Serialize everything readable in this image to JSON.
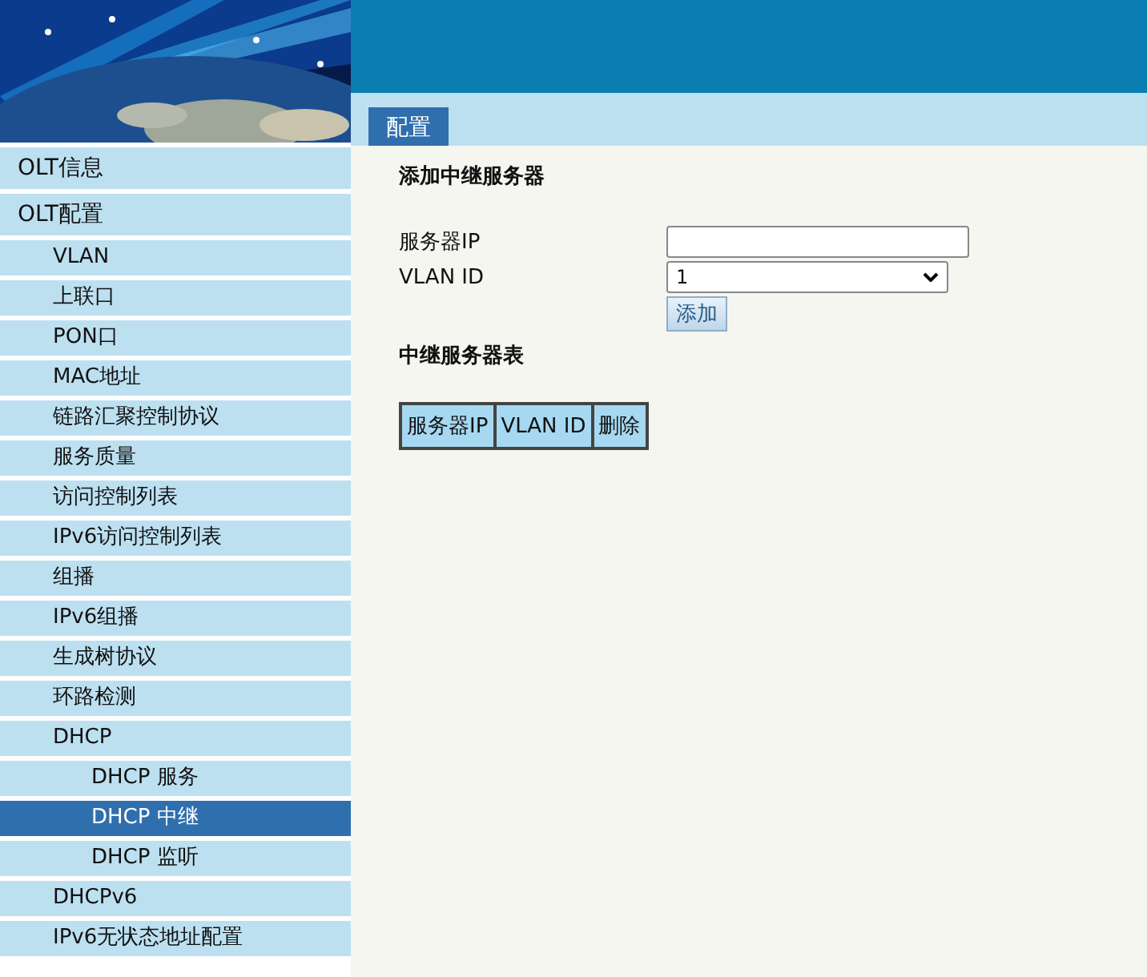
{
  "sidebar": {
    "items": [
      {
        "label": "OLT信息",
        "selected": false
      },
      {
        "label": "OLT配置",
        "selected": false,
        "children": [
          {
            "label": "VLAN",
            "selected": false
          },
          {
            "label": "上联口",
            "selected": false
          },
          {
            "label": "PON口",
            "selected": false
          },
          {
            "label": "MAC地址",
            "selected": false
          },
          {
            "label": "链路汇聚控制协议",
            "selected": false
          },
          {
            "label": "服务质量",
            "selected": false
          },
          {
            "label": "访问控制列表",
            "selected": false
          },
          {
            "label": "IPv6访问控制列表",
            "selected": false
          },
          {
            "label": "组播",
            "selected": false
          },
          {
            "label": "IPv6组播",
            "selected": false
          },
          {
            "label": "生成树协议",
            "selected": false
          },
          {
            "label": "环路检测",
            "selected": false
          },
          {
            "label": "DHCP",
            "selected": false,
            "children": [
              {
                "label": "DHCP 服务",
                "selected": false
              },
              {
                "label": "DHCP 中继",
                "selected": true
              },
              {
                "label": "DHCP 监听",
                "selected": false
              }
            ]
          },
          {
            "label": "DHCPv6",
            "selected": false
          },
          {
            "label": "IPv6无状态地址配置",
            "selected": false
          }
        ]
      }
    ]
  },
  "tabs": [
    {
      "label": "配置",
      "selected": true
    }
  ],
  "form": {
    "title": "添加中继服务器",
    "fields": [
      {
        "kind": "text",
        "label": "服务器IP"
      },
      {
        "kind": "select",
        "label": "VLAN ID",
        "value": "1"
      }
    ],
    "button": "添加"
  },
  "table": {
    "title": "中继服务器表",
    "columns": [
      "服务器IP",
      "VLAN ID",
      "删除"
    ]
  }
}
